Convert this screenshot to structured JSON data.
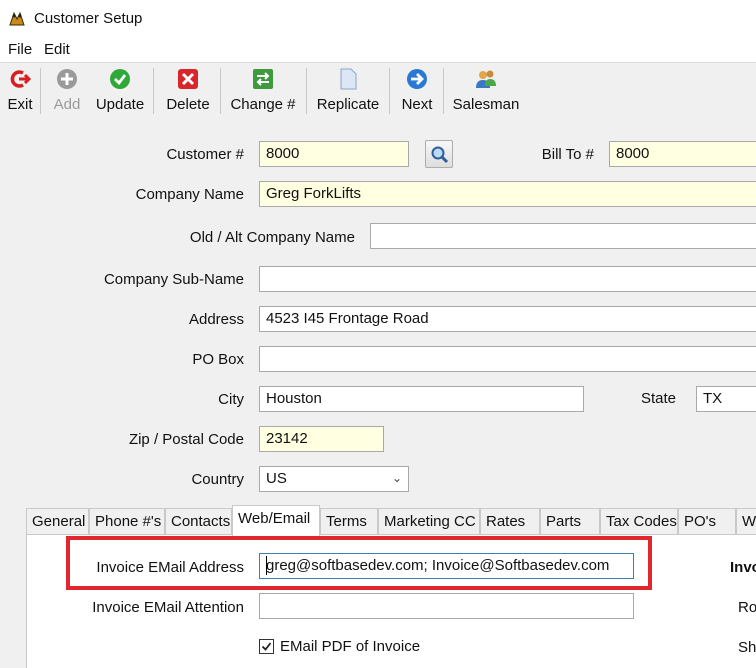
{
  "window": {
    "title": "Customer Setup"
  },
  "menu": {
    "file": "File",
    "edit": "Edit"
  },
  "toolbar": {
    "exit": "Exit",
    "add": "Add",
    "update": "Update",
    "delete": "Delete",
    "change": "Change #",
    "replicate": "Replicate",
    "next": "Next",
    "salesman": "Salesman"
  },
  "form": {
    "customer_no": {
      "label": "Customer #",
      "value": "8000"
    },
    "bill_to": {
      "label": "Bill To #",
      "value": "8000"
    },
    "company_name": {
      "label": "Company Name",
      "value": "Greg ForkLifts"
    },
    "alt_company": {
      "label": "Old / Alt Company Name",
      "value": ""
    },
    "sub_name": {
      "label": "Company Sub-Name",
      "value": ""
    },
    "address": {
      "label": "Address",
      "value": "4523 I45 Frontage Road"
    },
    "po_box": {
      "label": "PO Box",
      "value": ""
    },
    "city": {
      "label": "City",
      "value": "Houston"
    },
    "state": {
      "label": "State",
      "value": "TX"
    },
    "zip": {
      "label": "Zip / Postal Code",
      "value": "23142"
    },
    "country": {
      "label": "Country",
      "value": "US"
    }
  },
  "tabs": [
    "General",
    "Phone #'s",
    "Contacts",
    "Web/Email",
    "Terms",
    "Marketing CC",
    "Rates",
    "Parts",
    "Tax Codes",
    "PO's",
    "W"
  ],
  "active_tab": "Web/Email",
  "web_email": {
    "invoice_email_label": "Invoice EMail Address",
    "invoice_email_value": "greg@softbasedev.com; Invoice@Softbasedev.com",
    "invoice_attention_label": "Invoice EMail Attention",
    "invoice_attention_value": "",
    "email_pdf_label": "EMail PDF of Invoice",
    "email_pdf_checked": true,
    "right_col_1": "Invo",
    "right_col_2": "Ro",
    "right_col_3": "Sh"
  },
  "colors": {
    "highlight": "#e0272d",
    "required_field": "#ffffe1"
  }
}
